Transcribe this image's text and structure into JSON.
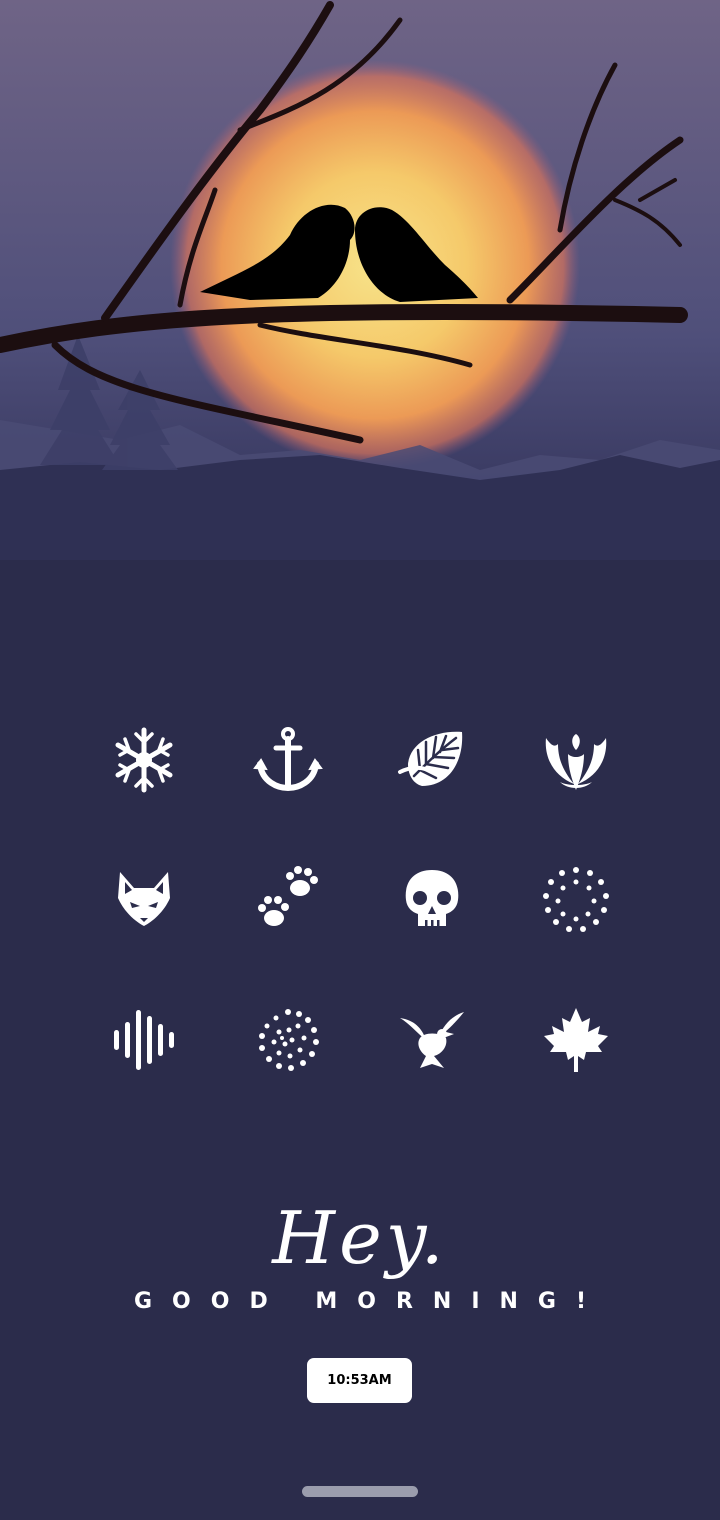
{
  "wallpaper": {
    "sky_top": "#6f6486",
    "sky_bottom": "#3b3d66",
    "sun_core": "#f7df80",
    "sun_edge": "#e97d4a",
    "ground": "#2b2c4b"
  },
  "icons": [
    {
      "name": "snowflake-icon"
    },
    {
      "name": "anchor-icon"
    },
    {
      "name": "leaf-icon"
    },
    {
      "name": "phoenix-icon"
    },
    {
      "name": "fox-icon"
    },
    {
      "name": "paw-prints-icon"
    },
    {
      "name": "skull-icon"
    },
    {
      "name": "dotted-circle-icon"
    },
    {
      "name": "sound-wave-icon"
    },
    {
      "name": "dotted-spiral-icon"
    },
    {
      "name": "dove-icon"
    },
    {
      "name": "maple-leaf-icon"
    }
  ],
  "greeting": {
    "hey": "Hey.",
    "subtitle": "GOOD MORNING!"
  },
  "clock": {
    "time": "10:53AM"
  }
}
